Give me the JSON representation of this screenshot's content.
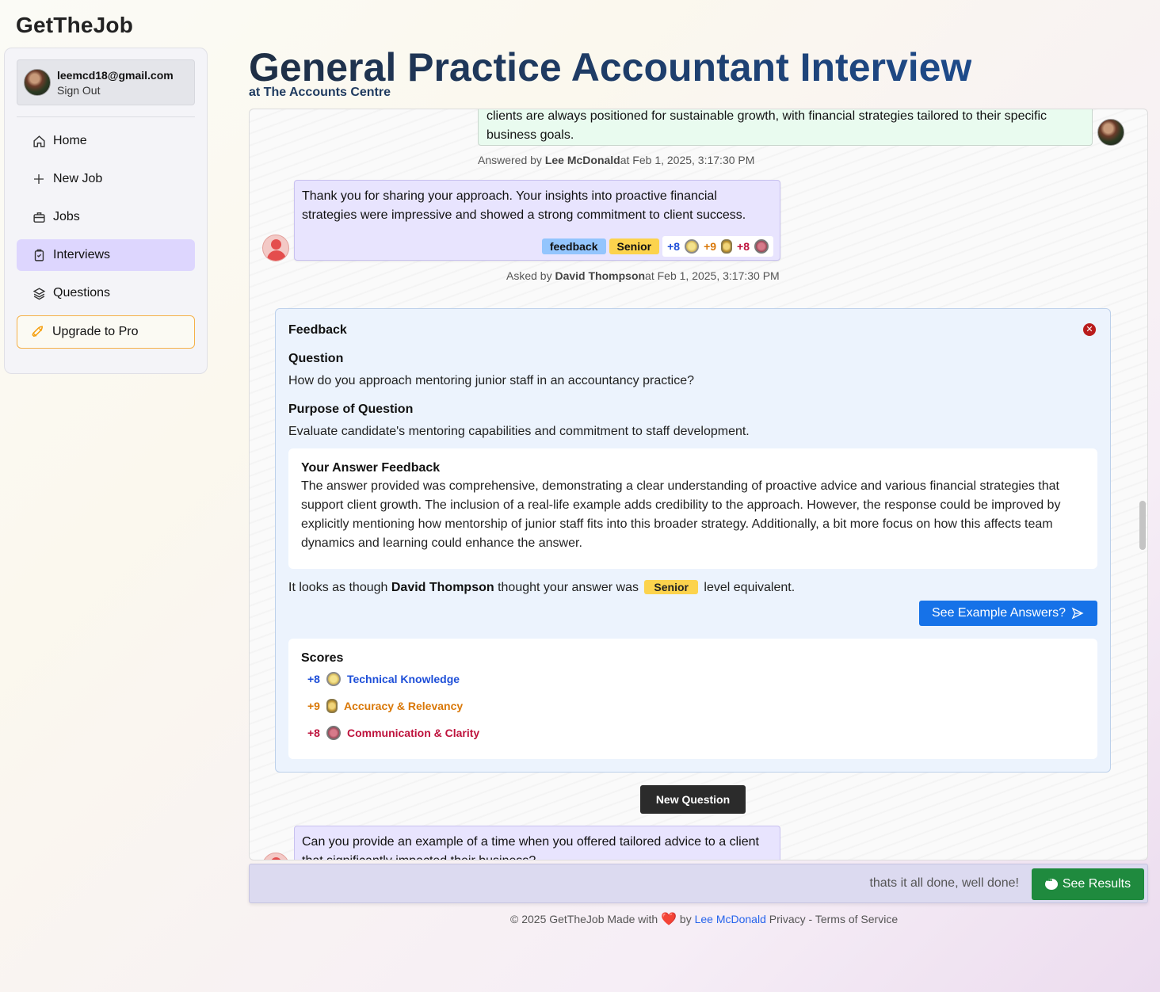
{
  "app": {
    "brand": "GetTheJob"
  },
  "user": {
    "email": "leemcd18@gmail.com",
    "sign_out": "Sign Out"
  },
  "nav": {
    "items": [
      {
        "label": "Home",
        "icon": "home-icon"
      },
      {
        "label": "New Job",
        "icon": "plus-icon"
      },
      {
        "label": "Jobs",
        "icon": "briefcase-icon"
      },
      {
        "label": "Interviews",
        "icon": "clipboard-icon",
        "active": true
      },
      {
        "label": "Questions",
        "icon": "layers-icon"
      }
    ],
    "upgrade": "Upgrade to Pro"
  },
  "header": {
    "title": "General Practice Accountant Interview",
    "subtitle": "at The Accounts Centre"
  },
  "chat": {
    "answer_snippet": "clients are always positioned for sustainable growth, with financial strategies tailored to their specific business goals.",
    "answered_by_prefix": "Answered by ",
    "answered_by_name": "Lee McDonald",
    "answered_by_time": "at Feb 1, 2025, 3:17:30 PM",
    "reply_text": "Thank you for sharing your approach. Your insights into proactive financial strategies were impressive and showed a strong commitment to client success.",
    "tags": {
      "feedback": "feedback",
      "level": "Senior"
    },
    "scores": [
      {
        "value": "+8",
        "label": "Technical Knowledge",
        "icon": "star-medal-icon",
        "color": "#1d4ed8"
      },
      {
        "value": "+9",
        "label": "Accuracy & Relevancy",
        "icon": "shield-medal-icon",
        "color": "#d97706"
      },
      {
        "value": "+8",
        "label": "Communication & Clarity",
        "icon": "heart-medal-icon",
        "color": "#be123c"
      }
    ],
    "asked_by_prefix": "Asked by ",
    "asked_by_name": "David Thompson",
    "asked_by_time": "at Feb 1, 2025, 3:17:30 PM",
    "next_question": "Can you provide an example of a time when you offered tailored advice to a client that significantly impacted their business?"
  },
  "feedback": {
    "title": "Feedback",
    "question_heading": "Question",
    "question": "How do you approach mentoring junior staff in an accountancy practice?",
    "purpose_heading": "Purpose of Question",
    "purpose": "Evaluate candidate's mentoring capabilities and commitment to staff development.",
    "answer_heading": "Your Answer Feedback",
    "answer_feedback": "The answer provided was comprehensive, demonstrating a clear understanding of proactive advice and various financial strategies that support client growth. The inclusion of a real-life example adds credibility to the approach. However, the response could be improved by explicitly mentioning how mentorship of junior staff fits into this broader strategy. Additionally, a bit more focus on how this affects team dynamics and learning could enhance the answer.",
    "level_prefix": "It looks as though ",
    "level_name": "David Thompson",
    "level_mid": " thought your answer was ",
    "level": "Senior",
    "level_suffix": " level equivalent.",
    "example_button": "See Example Answers?",
    "scores_heading": "Scores"
  },
  "actions": {
    "new_question": "New Question"
  },
  "input": {
    "value": "thats it all done, well done!",
    "results_button": "See Results"
  },
  "footer": {
    "copyright": "© 2025 GetTheJob  Made with",
    "by": " by ",
    "author": "Lee McDonald",
    "links": "Privacy - Terms of Service"
  },
  "colors": {
    "accent": "#1672e8",
    "success": "#1f8a3e",
    "nav_active": "#ddd6fe"
  }
}
